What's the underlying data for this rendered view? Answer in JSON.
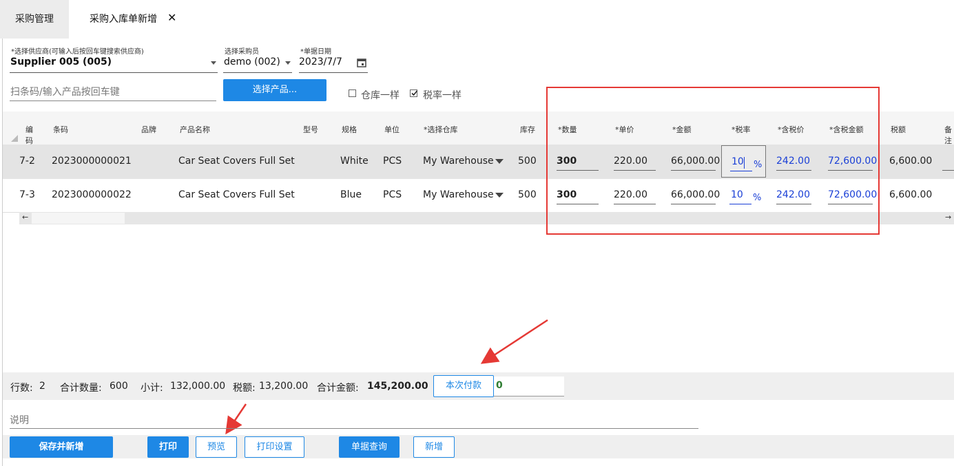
{
  "tabs": {
    "tab1": "采购管理",
    "tab2": "采购入库单新增",
    "close": "✕"
  },
  "form": {
    "supplier_label": "*选择供应商(可输入后按回车键搜索供应商)",
    "supplier_value": "Supplier 005 (005)",
    "buyer_label": "选择采购员",
    "buyer_value": "demo (002)",
    "date_label": "*单据日期",
    "date_value": "2023/7/7",
    "barcode_placeholder": "扫条码/输入产品按回车键",
    "select_product": "选择产品...",
    "same_warehouse": "仓库一样",
    "same_taxrate": "税率一样"
  },
  "columns": [
    "编码",
    "条码",
    "品牌",
    "产品名称",
    "型号",
    "规格",
    "单位",
    "*选择仓库",
    "库存",
    "*数量",
    "*单价",
    "*金额",
    "*税率",
    "*含税价",
    "*含税金额",
    "税额",
    "备注"
  ],
  "rows": [
    {
      "code": "7-2",
      "barcode": "2023000000021",
      "brand": "",
      "name": "Car Seat Covers Full Set",
      "model": "",
      "spec": "White",
      "unit": "PCS",
      "warehouse": "My Warehouse",
      "stock": "500",
      "qty": "300",
      "price": "220.00",
      "amount": "66,000.00",
      "taxrate": "10",
      "pct": "%",
      "taxprice": "242.00",
      "taxamount": "72,600.00",
      "tax": "6,600.00"
    },
    {
      "code": "7-3",
      "barcode": "2023000000022",
      "brand": "",
      "name": "Car Seat Covers Full Set",
      "model": "",
      "spec": "Blue",
      "unit": "PCS",
      "warehouse": "My Warehouse",
      "stock": "500",
      "qty": "300",
      "price": "220.00",
      "amount": "66,000.00",
      "taxrate": "10",
      "pct": "%",
      "taxprice": "242.00",
      "taxamount": "72,600.00",
      "tax": "6,600.00"
    }
  ],
  "scroll": {
    "left": "←",
    "right": "→"
  },
  "summary": {
    "rows_label": "行数:",
    "rows_value": "2",
    "qty_label": "合计数量:",
    "qty_value": "600",
    "subtotal_label": "小计:",
    "subtotal_value": "132,000.00",
    "tax_label": "税额:",
    "tax_value": "13,200.00",
    "total_label": "合计金额:",
    "total_value": "145,200.00",
    "pay_button": "本次付款",
    "pay_value": "0"
  },
  "note_placeholder": "说明",
  "buttons": {
    "save_new": "保存并新增",
    "print": "打印",
    "preview": "预览",
    "print_settings": "打印设置",
    "query": "单据查询",
    "new": "新增"
  },
  "colors": {
    "accent": "#1e88e5",
    "highlight": "#e53935",
    "link": "#1a3fd6",
    "pay_text": "#2e7d32"
  }
}
